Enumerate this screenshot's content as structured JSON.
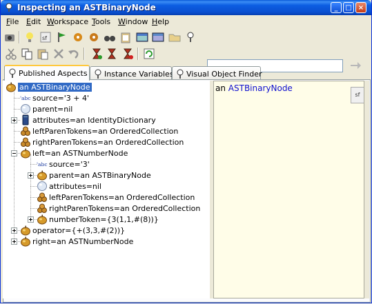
{
  "window": {
    "title": "Inspecting an ASTBinaryNode"
  },
  "menu": [
    {
      "label": "File",
      "u": "F",
      "rest": "ile"
    },
    {
      "label": "Edit",
      "u": "E",
      "rest": "dit"
    },
    {
      "label": "Workspace",
      "u": "W",
      "rest": "orkspace"
    },
    {
      "label": "Tools",
      "u": "T",
      "rest": "ools"
    },
    {
      "label": "Window",
      "u": "W",
      "rest": "indow"
    },
    {
      "label": "Help",
      "u": "H",
      "rest": "elp"
    }
  ],
  "tabs": [
    {
      "label": "Published Aspects",
      "active": true
    },
    {
      "label": "Instance Variables",
      "active": false
    },
    {
      "label": "Visual Object Finder",
      "active": false
    }
  ],
  "tree": [
    {
      "text": "an ASTBinaryNode",
      "icon": "apple-icon",
      "expander": "",
      "selected": true
    },
    {
      "text": "source='3 + 4'",
      "icon": "abc-string-icon",
      "expander": ""
    },
    {
      "text": "parent=nil",
      "icon": "nil-sphere-icon",
      "expander": ""
    },
    {
      "text": "attributes=an IdentityDictionary",
      "icon": "dictionary-icon",
      "expander": "plus"
    },
    {
      "text": "leftParenTokens=an OrderedCollection",
      "icon": "collection-icon",
      "expander": ""
    },
    {
      "text": "rightParenTokens=an OrderedCollection",
      "icon": "collection-icon",
      "expander": ""
    },
    {
      "text": "left=an ASTNumberNode",
      "icon": "apple-icon",
      "expander": "minus"
    },
    {
      "text": "source='3'",
      "icon": "abc-string-icon",
      "expander": ""
    },
    {
      "text": "parent=an ASTBinaryNode",
      "icon": "apple-icon",
      "expander": "plus"
    },
    {
      "text": "attributes=nil",
      "icon": "nil-sphere-icon",
      "expander": ""
    },
    {
      "text": "leftParenTokens=an OrderedCollection",
      "icon": "collection-icon",
      "expander": ""
    },
    {
      "text": "rightParenTokens=an OrderedCollection",
      "icon": "collection-icon",
      "expander": ""
    },
    {
      "text": "numberToken={3(1,1,#(8))}",
      "icon": "apple-icon",
      "expander": "plus"
    },
    {
      "text": "operator={+(3,3,#(2))}",
      "icon": "apple-icon",
      "expander": "plus"
    },
    {
      "text": "right=an ASTNumberNode",
      "icon": "apple-icon",
      "expander": "plus"
    }
  ],
  "detail": {
    "prefix": "an ",
    "classname": "ASTBinaryNode",
    "side_tab": "sf"
  },
  "search": {
    "value": ""
  },
  "icon_labels": {
    "abc": "'abc'"
  },
  "colors": {
    "title_bar": "#0a5bd9",
    "selection": "#316ac5",
    "detail_bg": "#fffde8",
    "active_tab_accent": "#ffc83c"
  }
}
